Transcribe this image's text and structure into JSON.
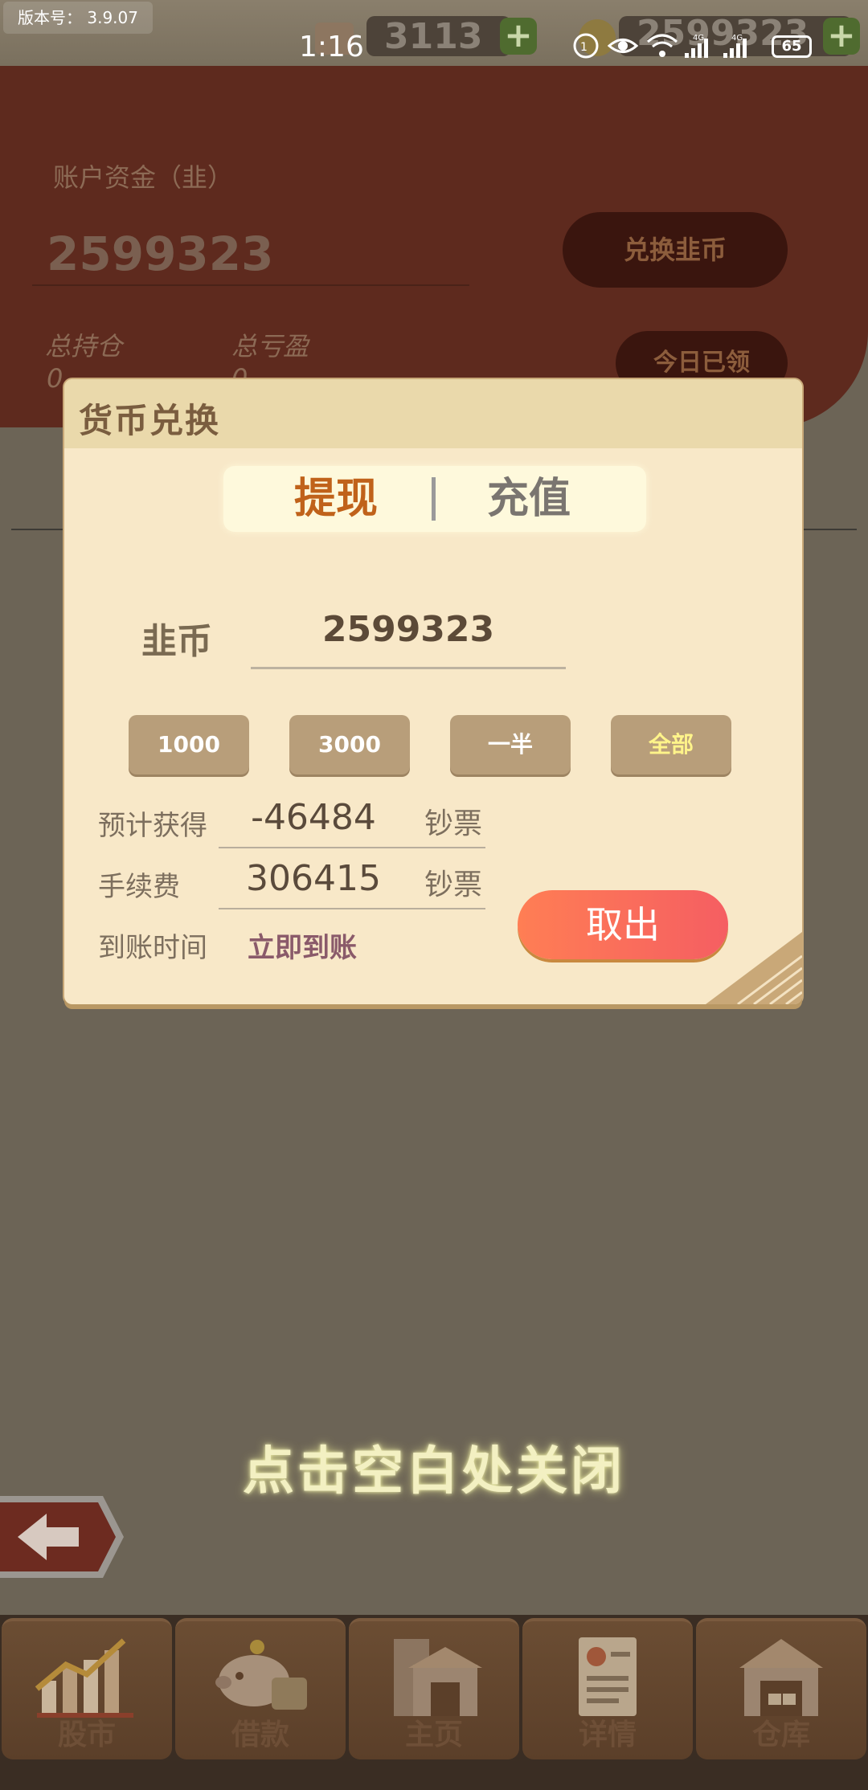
{
  "app": {
    "version_label": "版本号：  3.9.07",
    "status_time": "1:16",
    "battery": "65"
  },
  "resources": {
    "box_count": "3113",
    "coin_count": "2599323"
  },
  "account": {
    "label": "账户资金（韭）",
    "balance": "2599323",
    "exchange_button": "兑换韭币",
    "total_holdings_label": "总持仓",
    "total_holdings_value": "0",
    "total_pnl_label": "总亏盈",
    "total_pnl_value": "0",
    "daily_claim_button": "今日已领"
  },
  "modal": {
    "title": "货币兑换",
    "tabs": [
      {
        "label": "提现",
        "active": true
      },
      {
        "label": "充值",
        "active": false
      }
    ],
    "coin_label": "韭币",
    "coin_amount": "2599323",
    "quick_amounts": [
      "1000",
      "3000",
      "一半",
      "全部"
    ],
    "expected_label": "预计获得",
    "expected_value": "-46484",
    "expected_unit": "钞票",
    "fee_label": "手续费",
    "fee_value": "306415",
    "fee_unit": "钞票",
    "arrival_label": "到账时间",
    "arrival_value": "立即到账",
    "withdraw_button": "取出"
  },
  "close_hint": "点击空白处关闭",
  "bottom_nav": [
    {
      "label": "股市",
      "icon": "stock-chart-icon"
    },
    {
      "label": "借款",
      "icon": "piggy-bank-icon"
    },
    {
      "label": "主页",
      "icon": "home-building-icon"
    },
    {
      "label": "详情",
      "icon": "profile-document-icon"
    },
    {
      "label": "仓库",
      "icon": "warehouse-icon"
    }
  ],
  "colors": {
    "tab_active": "#c0621a",
    "tab_inactive": "#7a7570",
    "quick_all_text": "#fff48a",
    "withdraw_start": "#ff7e54",
    "withdraw_end": "#f55e62"
  }
}
